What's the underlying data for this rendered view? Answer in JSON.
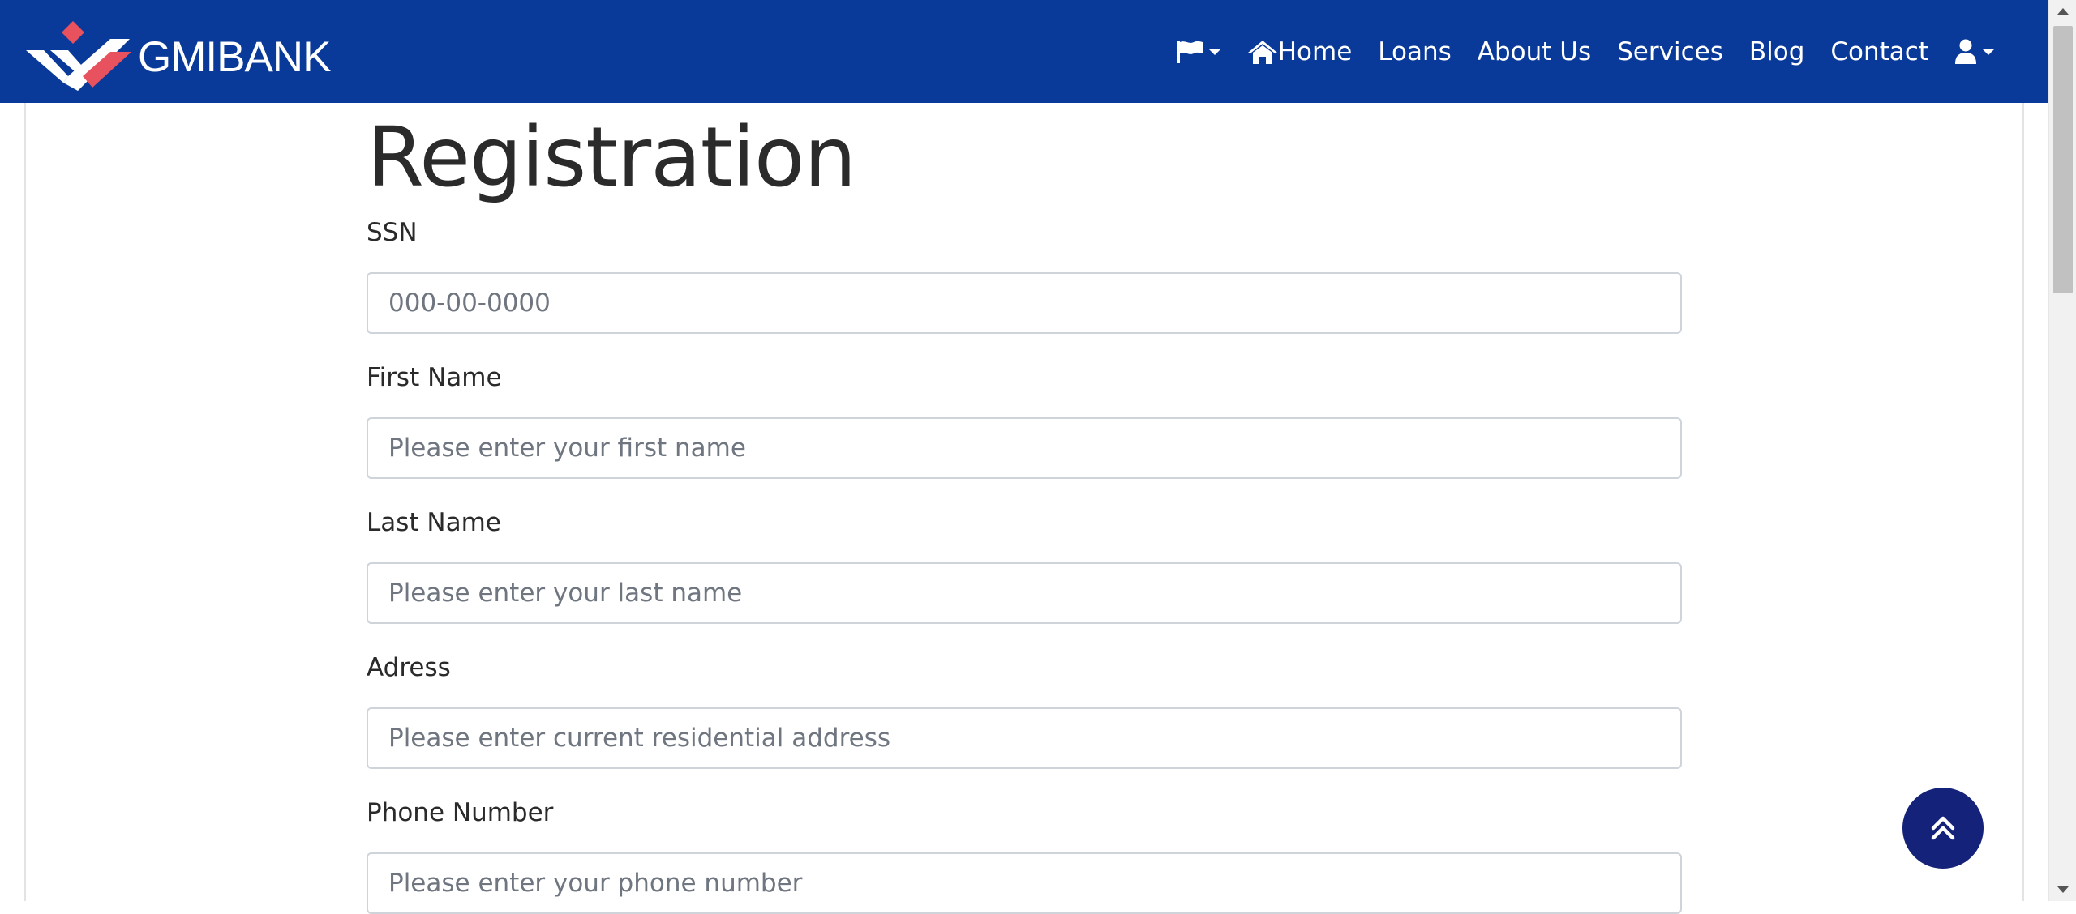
{
  "brand": {
    "name": "GMIBANK"
  },
  "nav": {
    "language_icon": "flag-icon",
    "home": "Home",
    "loans": "Loans",
    "about": "About Us",
    "services": "Services",
    "blog": "Blog",
    "contact": "Contact",
    "account_icon": "user-icon"
  },
  "page": {
    "title": "Registration"
  },
  "form": {
    "ssn": {
      "label": "SSN",
      "placeholder": "000-00-0000"
    },
    "first_name": {
      "label": "First Name",
      "placeholder": "Please enter your first name"
    },
    "last_name": {
      "label": "Last Name",
      "placeholder": "Please enter your last name"
    },
    "address": {
      "label": "Adress",
      "placeholder": "Please enter current residential address"
    },
    "phone": {
      "label": "Phone Number",
      "placeholder": "Please enter your phone number"
    }
  },
  "scroll_top": {
    "icon": "double-chevron-up-icon"
  },
  "colors": {
    "navbar": "#0a3a99",
    "logo_accent": "#e8525f",
    "scroll_button": "#14227a"
  }
}
